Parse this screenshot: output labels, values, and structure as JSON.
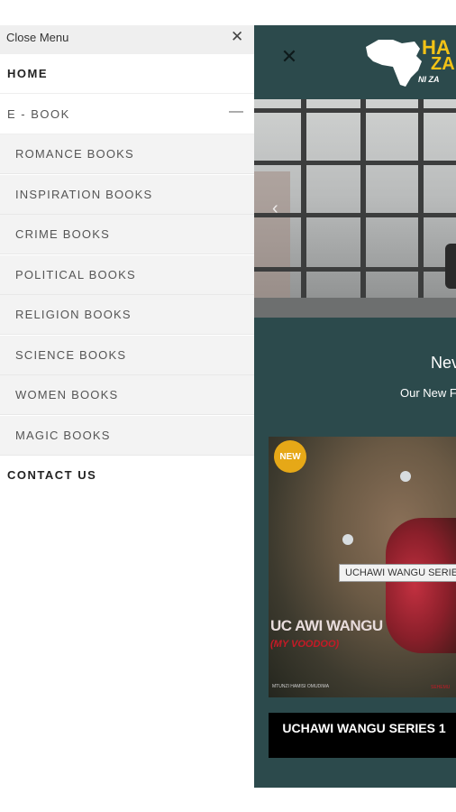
{
  "menu": {
    "close_label": "Close Menu",
    "close_icon": "close-icon",
    "home": "HOME",
    "ebook": "E - BOOK",
    "ebook_toggle": "—",
    "subitems": [
      {
        "label": "ROMANCE BOOKS"
      },
      {
        "label": "INSPIRATION BOOKS"
      },
      {
        "label": "CRIME BOOKS"
      },
      {
        "label": "POLITICAL BOOKS"
      },
      {
        "label": "RELIGION BOOKS"
      },
      {
        "label": "SCIENCE BOOKS"
      },
      {
        "label": "WOMEN BOOKS"
      },
      {
        "label": "MAGIC BOOKS"
      }
    ],
    "contact": "CONTACT US"
  },
  "page": {
    "close_glyph": "✕",
    "logo": {
      "line1": "HA",
      "line2": "ZA",
      "line3": "NI ZA"
    },
    "hero_arrow": "‹",
    "section_title": "Nev",
    "section_subtitle": "Our New F",
    "card": {
      "badge": "NEW",
      "image_label": "UCHAWI WANGU SERIE",
      "cover_title": "UC AWI WANGU",
      "cover_subtitle": "(MY VOODOO)",
      "cover_foot_left": "MTUNZI HAMISI OMUDIMA",
      "cover_foot_right": "SEHEMU",
      "title": "UCHAWI WANGU SERIES 1"
    }
  },
  "colors": {
    "page_bg": "#2c4a4c",
    "logo_yellow": "#f3c316",
    "badge": "#e6a817",
    "menu_sub_bg": "#f3f3f3"
  }
}
